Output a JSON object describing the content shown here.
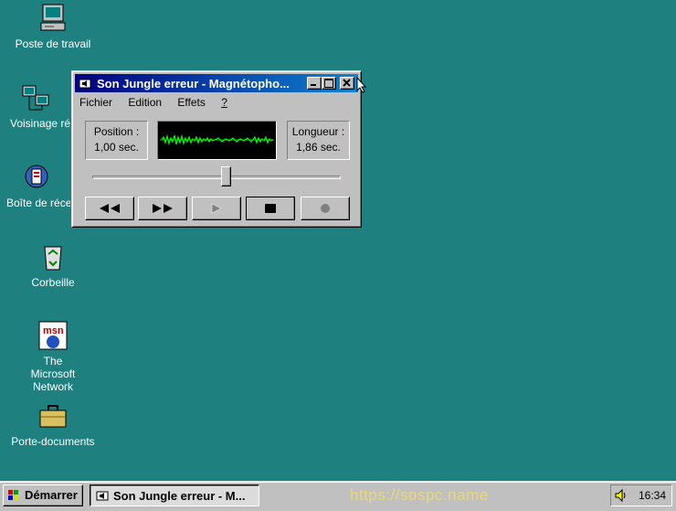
{
  "desktop": {
    "icons": [
      {
        "label": "Poste de travail",
        "icon": "computer-icon"
      },
      {
        "label": "Voisinage ré",
        "icon": "network-icon"
      },
      {
        "label": "Boîte de réce",
        "icon": "inbox-icon"
      },
      {
        "label": "Corbeille",
        "icon": "recycle-bin-icon"
      },
      {
        "label": "The Microsoft Network",
        "icon": "msn-icon"
      },
      {
        "label": "Porte-documents",
        "icon": "briefcase-icon"
      }
    ]
  },
  "window": {
    "title": "Son Jungle erreur - Magnétopho...",
    "menu": [
      "Fichier",
      "Edition",
      "Effets",
      "?"
    ],
    "position_label": "Position :",
    "position_value": "1,00 sec.",
    "length_label": "Longueur :",
    "length_value": "1,86 sec.",
    "playback_fraction": 0.54,
    "controls": [
      "seek-back",
      "seek-forward",
      "play",
      "stop",
      "record"
    ]
  },
  "taskbar": {
    "start_label": "Démarrer",
    "task_label": "Son Jungle erreur - M...",
    "watermark": "https://sospc.name",
    "clock": "16:34"
  },
  "colors": {
    "desktop": "#1f8080",
    "titlebar": "#000080",
    "wave": "#00ff00"
  }
}
